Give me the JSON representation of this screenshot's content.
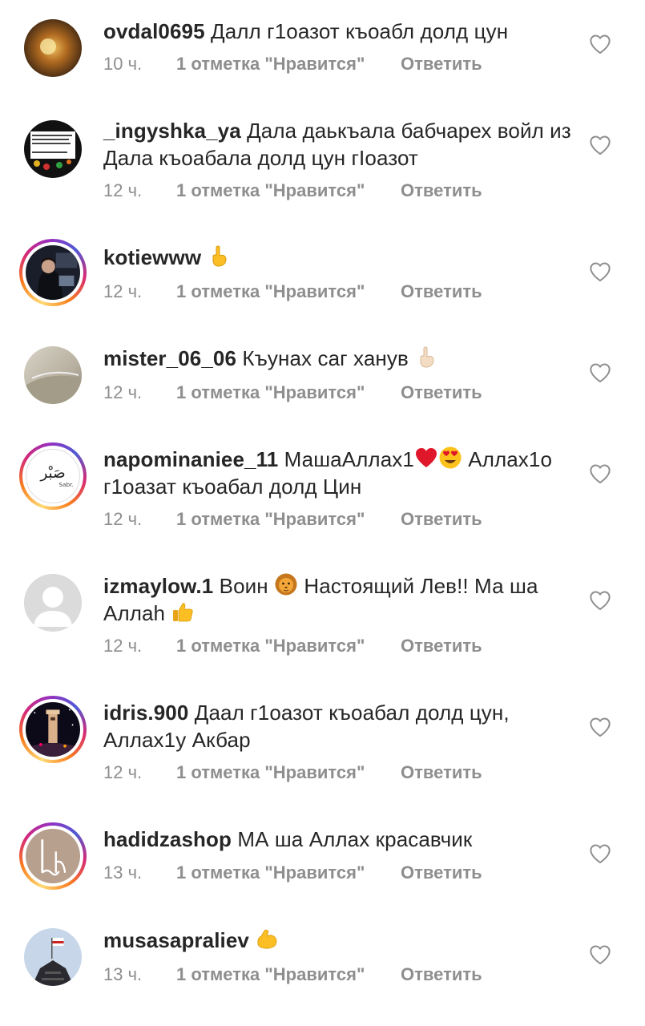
{
  "comments": [
    {
      "username": "ovdal0695",
      "text": "Далл г1оазот къоабл долд цун",
      "time": "10 ч.",
      "likes": "1 отметка \"Нравится\"",
      "reply": "Ответить"
    },
    {
      "username": "_ingyshka_ya",
      "text": "Дала даькъала бабчарех войл из Дала къоабала долд цун гIоазот",
      "time": "12 ч.",
      "likes": "1 отметка \"Нравится\"",
      "reply": "Ответить"
    },
    {
      "username": "kotiewww",
      "text": "",
      "time": "12 ч.",
      "likes": "1 отметка \"Нравится\"",
      "reply": "Ответить"
    },
    {
      "username": "mister_06_06",
      "text": "Къунах саг ханув",
      "time": "12 ч.",
      "likes": "1 отметка \"Нравится\"",
      "reply": "Ответить"
    },
    {
      "username": "napominaniee_11",
      "text_a": "МашаАллах1",
      "text_b": "Аллах1о г1оазат къоабал долд Цин",
      "avatar_text": "Sabr.",
      "time": "12 ч.",
      "likes": "1 отметка \"Нравится\"",
      "reply": "Ответить"
    },
    {
      "username": "izmaylow.1",
      "text_a": "Воин",
      "text_b": "Настоящий Лев!! Ма ша Аллаh",
      "time": "12 ч.",
      "likes": "1 отметка \"Нравится\"",
      "reply": "Ответить"
    },
    {
      "username": "idris.900",
      "text": "Даал г1оазот къоабал долд цун, Аллах1у Акбар",
      "time": "12 ч.",
      "likes": "1 отметка \"Нравится\"",
      "reply": "Ответить"
    },
    {
      "username": "hadidzashop",
      "text": "МА ша Аллах красавчик",
      "time": "13 ч.",
      "likes": "1 отметка \"Нравится\"",
      "reply": "Ответить"
    },
    {
      "username": "musasapraliev",
      "text": "",
      "time": "13 ч.",
      "likes": "1 отметка \"Нравится\"",
      "reply": "Ответить"
    }
  ],
  "icons": {
    "like": "heart-outline-icon",
    "emoji_point": "index-pointing-up",
    "emoji_heart": "red-heart",
    "emoji_love_eyes": "smiling-face-with-heart-eyes",
    "emoji_lion": "lion-face",
    "emoji_thumbs": "thumbs-up",
    "emoji_muscle": "flexed-biceps"
  },
  "colors": {
    "text": "#262626",
    "secondary": "#8e8e8e",
    "heart_stroke": "#8e8e8e"
  }
}
